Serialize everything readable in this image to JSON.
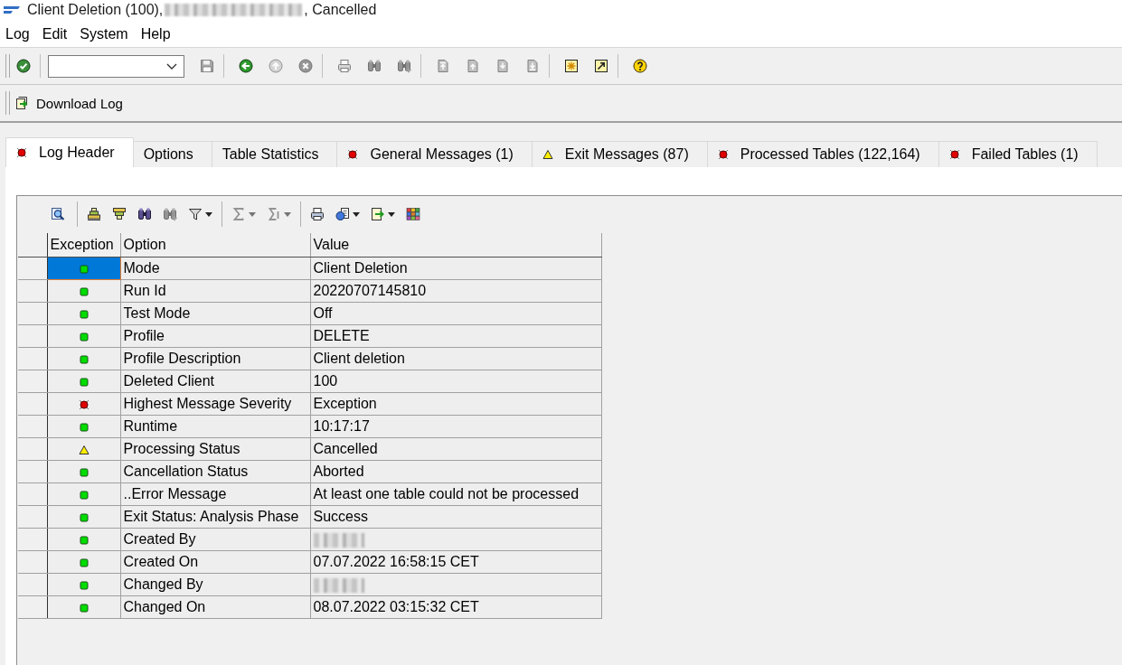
{
  "window": {
    "title_prefix": "Client Deletion (100),",
    "title_redacted": true,
    "title_suffix": ", Cancelled"
  },
  "menu": [
    {
      "label": "Log"
    },
    {
      "label": "Edit"
    },
    {
      "label": "System"
    },
    {
      "label": "Help"
    }
  ],
  "system_toolbar": {
    "groups": [
      [
        {
          "kind": "enter",
          "disabled": false
        }
      ],
      [
        {
          "kind": "command_field"
        },
        {
          "kind": "save",
          "disabled": true
        }
      ],
      [
        {
          "kind": "back",
          "disabled": false
        },
        {
          "kind": "exit",
          "disabled": true
        },
        {
          "kind": "cancel",
          "disabled": true
        }
      ],
      [
        {
          "kind": "print",
          "disabled": true
        },
        {
          "kind": "find",
          "disabled": true
        },
        {
          "kind": "find_next",
          "disabled": true
        }
      ],
      [
        {
          "kind": "first_page",
          "disabled": true
        },
        {
          "kind": "previous_page",
          "disabled": true
        },
        {
          "kind": "next_page",
          "disabled": true
        },
        {
          "kind": "last_page",
          "disabled": true
        }
      ],
      [
        {
          "kind": "new_session",
          "disabled": false
        },
        {
          "kind": "create_shortcut",
          "disabled": false
        }
      ],
      [
        {
          "kind": "help",
          "disabled": false
        }
      ]
    ]
  },
  "application_toolbar": {
    "buttons": [
      {
        "kind": "download",
        "label": "Download Log"
      }
    ]
  },
  "tabs": [
    {
      "label": "Log Header",
      "kind": "error",
      "selected": true
    },
    {
      "label": "Options",
      "kind": "plain",
      "selected": false
    },
    {
      "label": "Table Statistics",
      "kind": "plain",
      "selected": false
    },
    {
      "label": "General Messages (1)",
      "kind": "error",
      "selected": false
    },
    {
      "label": "Exit Messages (87)",
      "kind": "warning",
      "selected": false
    },
    {
      "label": "Processed Tables (122,164)",
      "kind": "error",
      "selected": false
    },
    {
      "label": "Failed Tables (1)",
      "kind": "error",
      "selected": false
    }
  ],
  "alv_toolbar": {
    "groups": [
      [
        {
          "kind": "details",
          "disabled": false,
          "menu": false
        }
      ],
      [
        {
          "kind": "sort_ascending",
          "disabled": false,
          "menu": false
        },
        {
          "kind": "sort_descending",
          "disabled": false,
          "menu": false
        },
        {
          "kind": "find",
          "disabled": false,
          "menu": false
        },
        {
          "kind": "find_next",
          "disabled": true,
          "menu": false
        },
        {
          "kind": "filter",
          "disabled": false,
          "menu": true
        }
      ],
      [
        {
          "kind": "sum",
          "disabled": true,
          "menu": true
        },
        {
          "kind": "subtotal",
          "disabled": true,
          "menu": true
        }
      ],
      [
        {
          "kind": "print",
          "disabled": false,
          "menu": false
        },
        {
          "kind": "views",
          "disabled": false,
          "menu": true
        },
        {
          "kind": "export",
          "disabled": false,
          "menu": true
        },
        {
          "kind": "layout",
          "disabled": false,
          "menu": false
        }
      ]
    ]
  },
  "table": {
    "columns": [
      "Exception",
      "Option",
      "Value"
    ],
    "rows": [
      {
        "kind": "ok",
        "option": "Mode",
        "value": "Client Deletion",
        "redacted": false,
        "selected": true
      },
      {
        "kind": "ok",
        "option": "Run Id",
        "value": "20220707145810",
        "redacted": false,
        "selected": false
      },
      {
        "kind": "ok",
        "option": "Test Mode",
        "value": "Off",
        "redacted": false,
        "selected": false
      },
      {
        "kind": "ok",
        "option": "Profile",
        "value": "DELETE",
        "redacted": false,
        "selected": false
      },
      {
        "kind": "ok",
        "option": "Profile Description",
        "value": "Client deletion",
        "redacted": false,
        "selected": false
      },
      {
        "kind": "ok",
        "option": "Deleted Client",
        "value": "100",
        "redacted": false,
        "selected": false
      },
      {
        "kind": "error",
        "option": "Highest Message Severity",
        "value": "Exception",
        "redacted": false,
        "selected": false
      },
      {
        "kind": "ok",
        "option": "Runtime",
        "value": "10:17:17",
        "redacted": false,
        "selected": false
      },
      {
        "kind": "warning",
        "option": "Processing Status",
        "value": "Cancelled",
        "redacted": false,
        "selected": false
      },
      {
        "kind": "ok",
        "option": "Cancellation Status",
        "value": "Aborted",
        "redacted": false,
        "selected": false
      },
      {
        "kind": "ok",
        "option": "..Error Message",
        "value": "At least one table could not be processed",
        "redacted": false,
        "selected": false
      },
      {
        "kind": "ok",
        "option": "Exit Status: Analysis Phase",
        "value": "Success",
        "redacted": false,
        "selected": false
      },
      {
        "kind": "ok",
        "option": "Created By",
        "redacted": true,
        "selected": false
      },
      {
        "kind": "ok",
        "option": "Created On",
        "value": "07.07.2022 16:58:15 CET",
        "redacted": false,
        "selected": false
      },
      {
        "kind": "ok",
        "option": "Changed By",
        "redacted": true,
        "selected": false
      },
      {
        "kind": "ok",
        "option": "Changed On",
        "value": "08.07.2022 03:15:32 CET",
        "redacted": false,
        "selected": false
      }
    ]
  }
}
